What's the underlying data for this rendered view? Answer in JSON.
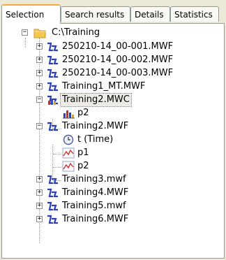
{
  "tabs": [
    {
      "label": "Selection",
      "active": true
    },
    {
      "label": "Search results",
      "active": false
    },
    {
      "label": "Details",
      "active": false
    },
    {
      "label": "Statistics",
      "active": false
    }
  ],
  "tree": {
    "root": {
      "label": "C:\\Training",
      "icon": "folder-icon",
      "expanded": true
    },
    "items": [
      {
        "label": "250210-14_00-001.MWF",
        "icon": "mwf-file-icon",
        "expanded": false
      },
      {
        "label": "250210-14_00-002.MWF",
        "icon": "mwf-file-icon",
        "expanded": false
      },
      {
        "label": "250210-14_00-003.MWF",
        "icon": "mwf-file-icon",
        "expanded": false
      },
      {
        "label": "Training1_MT.MWF",
        "icon": "mwf-file-icon",
        "expanded": false
      },
      {
        "label": "Training2.MWC",
        "icon": "mwc-file-icon",
        "expanded": true,
        "selected": true,
        "children": [
          {
            "label": "p2",
            "icon": "bar-chart-icon"
          }
        ]
      },
      {
        "label": "Training2.MWF",
        "icon": "mwf-file-icon",
        "expanded": true,
        "children": [
          {
            "label": "t (Time)",
            "icon": "clock-icon"
          },
          {
            "label": "p1",
            "icon": "line-chart-icon"
          },
          {
            "label": "p2",
            "icon": "line-chart-icon"
          }
        ]
      },
      {
        "label": "Training3.mwf",
        "icon": "mwf-file-icon",
        "expanded": false
      },
      {
        "label": "Training4.MWF",
        "icon": "mwf-file-icon",
        "expanded": false
      },
      {
        "label": "Training5.mwf",
        "icon": "mwf-file-icon",
        "expanded": false
      },
      {
        "label": "Training6.MWF",
        "icon": "mwf-file-icon",
        "expanded": false
      }
    ]
  }
}
